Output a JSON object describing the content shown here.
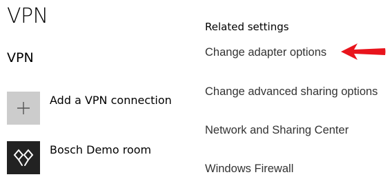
{
  "page": {
    "title": "VPN"
  },
  "vpn_section": {
    "title": "VPN",
    "add_connection": {
      "label": "Add a VPN connection",
      "icon": "plus-icon"
    },
    "connections": [
      {
        "label": "Bosch Demo room",
        "icon": "vpn-connection-icon"
      }
    ]
  },
  "related_settings": {
    "heading": "Related settings",
    "links": [
      "Change adapter options",
      "Change advanced sharing options",
      "Network and Sharing Center",
      "Windows Firewall"
    ],
    "highlight": {
      "icon": "red-arrow-icon",
      "color": "#e8141c",
      "points_to": "Change adapter options"
    }
  },
  "colors": {
    "background": "#ffffff",
    "tile_add": "#cccccc",
    "tile_vpn": "#222222",
    "arrow": "#e8141c"
  }
}
